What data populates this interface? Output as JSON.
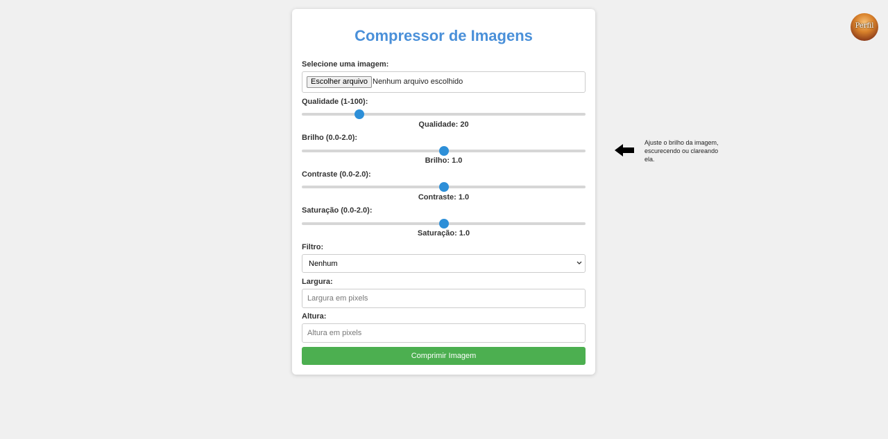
{
  "app": {
    "title": "Compressor de Imagens"
  },
  "file": {
    "label": "Selecione uma imagem:",
    "button_label": "Escolher arquivo",
    "status": "Nenhum arquivo escolhido"
  },
  "sliders": {
    "quality": {
      "label": "Qualidade (1-100):",
      "value_text": "Qualidade: 20",
      "min": 1,
      "max": 100,
      "value": 20
    },
    "brightness": {
      "label": "Brilho (0.0-2.0):",
      "value_text": "Brilho: 1.0",
      "min": 0,
      "max": 2,
      "value": 1.0
    },
    "contrast": {
      "label": "Contraste (0.0-2.0):",
      "value_text": "Contraste: 1.0",
      "min": 0,
      "max": 2,
      "value": 1.0
    },
    "saturation": {
      "label": "Saturação (0.0-2.0):",
      "value_text": "Saturação: 1.0",
      "min": 0,
      "max": 2,
      "value": 1.0
    }
  },
  "filter": {
    "label": "Filtro:",
    "selected": "Nenhum"
  },
  "width": {
    "label": "Largura:",
    "placeholder": "Largura em pixels"
  },
  "height": {
    "label": "Altura:",
    "placeholder": "Altura em pixels"
  },
  "submit": {
    "label": "Comprimir Imagem"
  },
  "hint": {
    "text": "Ajuste o brilho da imagem, escurecendo ou clareando ela.",
    "icon": "arrow-left-icon"
  },
  "profile": {
    "label": "Perfil"
  },
  "colors": {
    "accent": "#4a90d9",
    "slider_thumb": "#2d8fd8",
    "submit": "#4caf50",
    "background": "#f0f0f0"
  }
}
